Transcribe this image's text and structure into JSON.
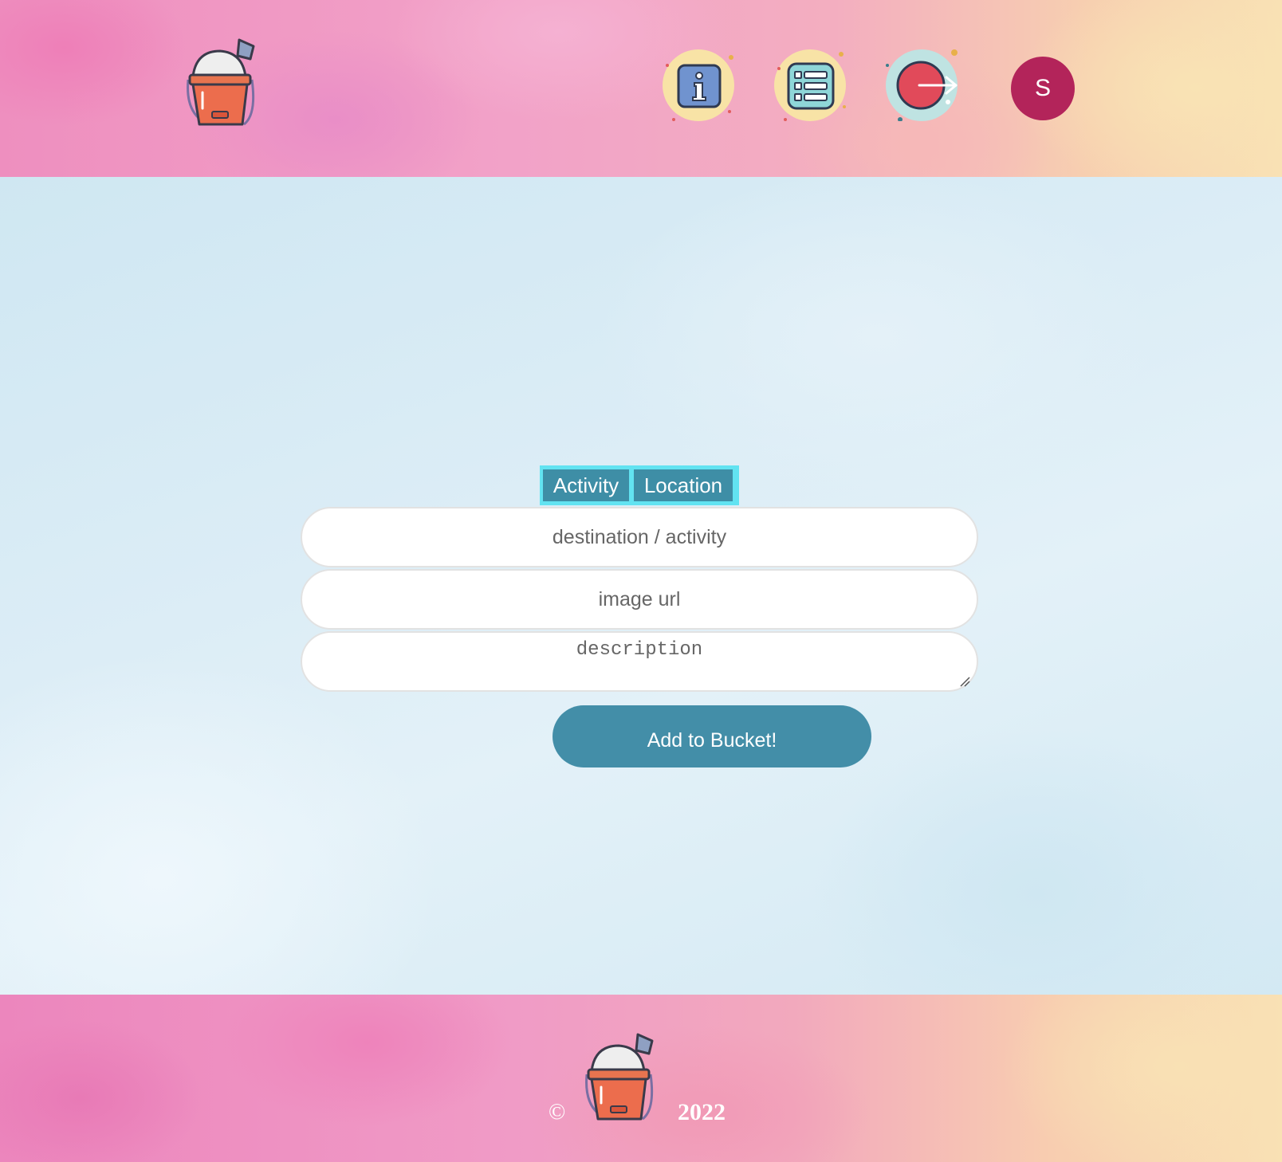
{
  "header": {
    "logo_icon": "bucket-and-shovel-icon",
    "nav": [
      {
        "name": "info-icon"
      },
      {
        "name": "list-icon"
      },
      {
        "name": "logout-icon"
      }
    ],
    "avatar_initial": "S"
  },
  "form": {
    "tabs": [
      "Activity",
      "Location"
    ],
    "destination_placeholder": "destination / activity",
    "image_placeholder": "image url",
    "description_placeholder": "description",
    "submit_label": "Add to Bucket!"
  },
  "footer": {
    "copyright_symbol": "©",
    "year": "2022"
  },
  "colors": {
    "accent": "#438ea8",
    "toggle_border": "#62e3f1",
    "avatar": "#b3245a"
  }
}
